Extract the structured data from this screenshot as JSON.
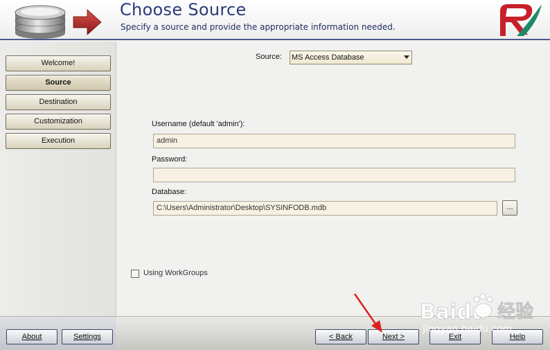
{
  "header": {
    "title": "Choose Source",
    "subtitle": "Specify a source and provide the appropriate information needed."
  },
  "sidebar": {
    "items": [
      {
        "label": "Welcome!",
        "active": false
      },
      {
        "label": "Source",
        "active": true
      },
      {
        "label": "Destination",
        "active": false
      },
      {
        "label": "Customization",
        "active": false
      },
      {
        "label": "Execution",
        "active": false
      }
    ]
  },
  "form": {
    "source_label": "Source:",
    "source_value": "MS Access Database",
    "username_label": "Username (default 'admin'):",
    "username_value": "admin",
    "password_label": "Password:",
    "password_value": "",
    "database_label": "Database:",
    "database_value": "C:\\Users\\Administrator\\Desktop\\SYSINFODB.mdb",
    "browse_label": "...",
    "workgroups_label": "Using WorkGroups",
    "workgroups_checked": false
  },
  "footer": {
    "about": "About",
    "settings": "Settings",
    "back": "< Back",
    "next": "Next >",
    "exit": "Exit",
    "help": "Help"
  },
  "watermark": {
    "brand": "Baidu",
    "cn": "经验",
    "url": "jingyan.baidu.com"
  },
  "colors": {
    "header_title": "#2b3a78",
    "annotation_arrow": "#e02020",
    "logo_red": "#c8202a",
    "logo_green": "#1f8a6a"
  }
}
